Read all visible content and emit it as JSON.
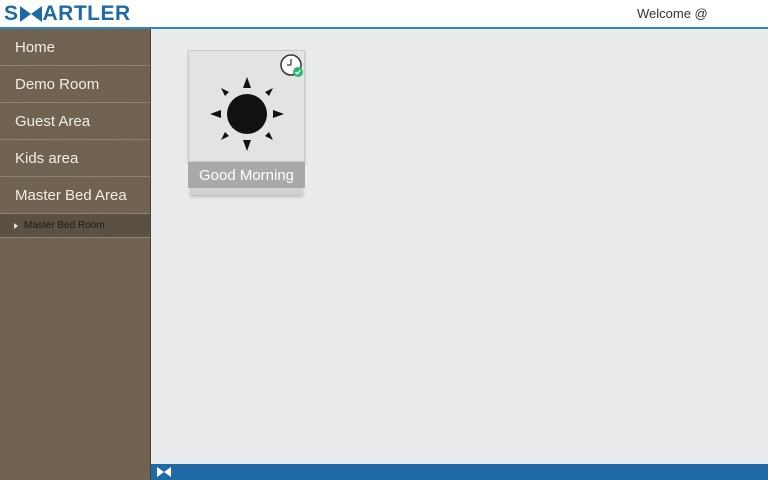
{
  "header": {
    "logo_text": "S ARTLER",
    "logo_letter_s": "S",
    "logo_rest": "ARTLER",
    "welcome": "Welcome @"
  },
  "sidebar": {
    "items": [
      {
        "label": "Home"
      },
      {
        "label": "Demo Room"
      },
      {
        "label": "Guest Area"
      },
      {
        "label": "Kids area"
      },
      {
        "label": "Master Bed Area"
      }
    ],
    "sub_item": {
      "label": "Master Bed Room"
    }
  },
  "tiles": [
    {
      "label": "Good Morning",
      "icon": "sun-icon",
      "badge": "scheduled-clock-icon"
    }
  ],
  "colors": {
    "accent": "#1f6aa6",
    "sidebar": "#6e6150",
    "badge_green": "#2bb573"
  }
}
